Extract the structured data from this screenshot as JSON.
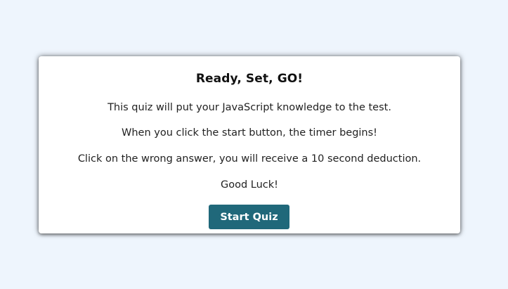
{
  "quiz_intro": {
    "title": "Ready, Set, GO!",
    "lines": [
      "This quiz will put your JavaScript knowledge to the test.",
      "When you click the start button, the timer begins!",
      "Click on the wrong answer, you will receive a 10 second deduction.",
      "Good Luck!"
    ],
    "start_button_label": "Start Quiz"
  },
  "colors": {
    "page_background": "#eef5fd",
    "card_background": "#ffffff",
    "button_background": "#20687a",
    "button_text": "#ffffff"
  }
}
